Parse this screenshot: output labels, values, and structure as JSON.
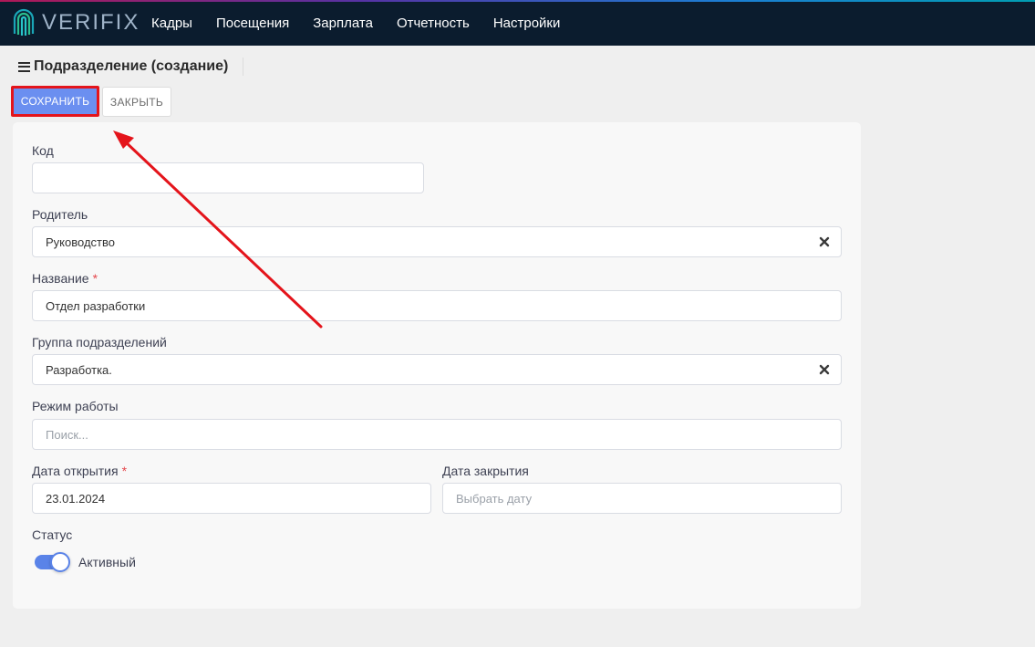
{
  "header": {
    "logo_text": "VERIFIX",
    "nav": [
      "Кадры",
      "Посещения",
      "Зарплата",
      "Отчетность",
      "Настройки"
    ]
  },
  "page": {
    "title": "Подразделение (создание)"
  },
  "toolbar": {
    "save_label": "СОХРАНИТЬ",
    "close_label": "ЗАКРЫТЬ"
  },
  "form": {
    "code": {
      "label": "Код",
      "value": ""
    },
    "parent": {
      "label": "Родитель",
      "value": "Руководство"
    },
    "name": {
      "label": "Название",
      "required_mark": "*",
      "value": "Отдел разработки"
    },
    "group": {
      "label": "Группа подразделений",
      "value": "Разработка."
    },
    "schedule": {
      "label": "Режим работы",
      "placeholder": "Поиск..."
    },
    "open_date": {
      "label": "Дата открытия",
      "required_mark": "*",
      "value": "23.01.2024"
    },
    "close_date": {
      "label": "Дата закрытия",
      "placeholder": "Выбрать дату"
    },
    "status": {
      "label": "Статус",
      "value": "Активный",
      "on": true
    }
  },
  "colors": {
    "topbar": "#0b1c2e",
    "primary": "#6b8ff0",
    "highlight": "#e4141b",
    "toggle": "#5a83e8"
  },
  "icons": {
    "logo": "fingerprint-icon",
    "menu": "hamburger-icon",
    "clear": "close-icon",
    "annotation": "arrow-annotation"
  }
}
